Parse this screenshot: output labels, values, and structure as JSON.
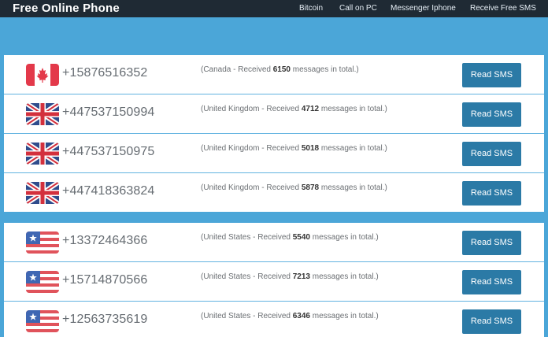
{
  "header": {
    "brand": "Free Online Phone",
    "nav": [
      "Bitcoin",
      "Call on PC",
      "Messenger Iphone",
      "Receive Free SMS"
    ]
  },
  "groups": [
    {
      "rows": [
        {
          "flag": "canada-flag-icon",
          "number": "+15876516352",
          "country": "Canada",
          "prefix": "(Canada - Received ",
          "count": "6150",
          "suffix": " messages in total.)",
          "button": "Read SMS"
        },
        {
          "flag": "uk-flag-icon",
          "number": "+447537150994",
          "country": "United Kingdom",
          "prefix": "(United Kingdom - Received ",
          "count": "4712",
          "suffix": " messages in total.)",
          "button": "Read SMS"
        },
        {
          "flag": "uk-flag-icon",
          "number": "+447537150975",
          "country": "United Kingdom",
          "prefix": "(United Kingdom - Received ",
          "count": "5018",
          "suffix": " messages in total.)",
          "button": "Read SMS"
        },
        {
          "flag": "uk-flag-icon",
          "number": "+447418363824",
          "country": "United Kingdom",
          "prefix": "(United Kingdom - Received ",
          "count": "5878",
          "suffix": " messages in total.)",
          "button": "Read SMS"
        }
      ]
    },
    {
      "rows": [
        {
          "flag": "us-flag-icon",
          "number": "+13372464366",
          "country": "United States",
          "prefix": "(United States - Received ",
          "count": "5540",
          "suffix": " messages in total.)",
          "button": "Read SMS"
        },
        {
          "flag": "us-flag-icon",
          "number": "+15714870566",
          "country": "United States",
          "prefix": "(United States - Received ",
          "count": "7213",
          "suffix": " messages in total.)",
          "button": "Read SMS"
        },
        {
          "flag": "us-flag-icon",
          "number": "+12563735619",
          "country": "United States",
          "prefix": "(United States - Received ",
          "count": "6346",
          "suffix": " messages in total.)",
          "button": "Read SMS"
        }
      ]
    }
  ],
  "colors": {
    "navbar": "#1f2a34",
    "background": "#4ba6d8",
    "button": "#2b7aa6",
    "divider": "#62b3e0"
  }
}
